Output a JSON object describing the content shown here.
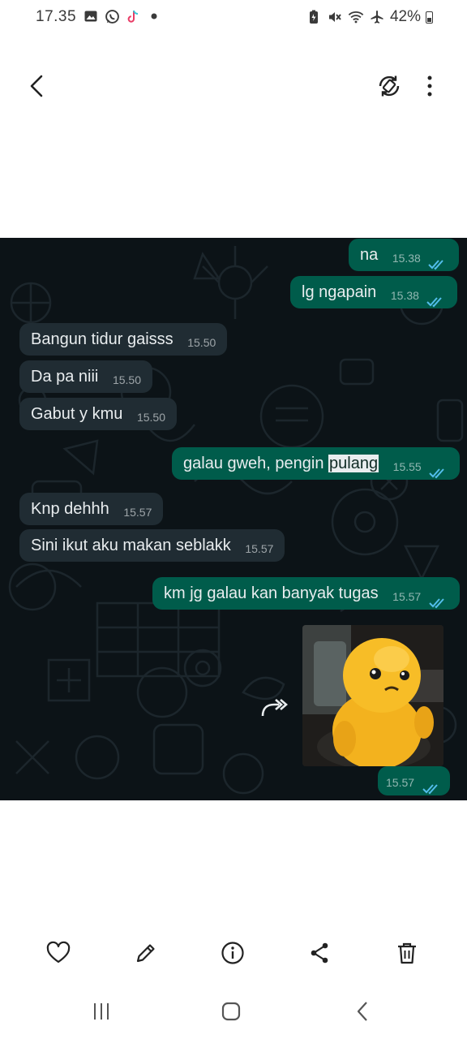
{
  "status_bar": {
    "time": "17.35",
    "left_icons": [
      "gallery-icon",
      "whatsapp-icon",
      "tiktok-icon",
      "dot-icon"
    ],
    "right_icons": [
      "battery-saver-icon",
      "mute-icon",
      "wifi-icon",
      "airplane-icon"
    ],
    "battery": "42%"
  },
  "app_bar": {
    "back_icon": "back-arrow-icon",
    "rotate_icon": "rotate-icon",
    "more_icon": "more-vert-icon"
  },
  "messages": [
    {
      "direction": "out",
      "text": "na",
      "time": "15.38",
      "read": true
    },
    {
      "direction": "out",
      "text": "lg ngapain",
      "time": "15.38",
      "read": true
    },
    {
      "direction": "in",
      "text": "Bangun tidur gaisss",
      "time": "15.50"
    },
    {
      "direction": "in",
      "text": "Da pa niii",
      "time": "15.50"
    },
    {
      "direction": "in",
      "text": "Gabut y kmu",
      "time": "15.50"
    },
    {
      "direction": "out",
      "text_before": "galau gweh, pengin ",
      "text_highlight": "pulang",
      "time": "15.55",
      "read": true
    },
    {
      "direction": "in",
      "text": "Knp dehhh",
      "time": "15.57"
    },
    {
      "direction": "in",
      "text": "Sini ikut aku makan seblakk",
      "time": "15.57"
    },
    {
      "direction": "out",
      "text": "km jg galau kan banyak tugas",
      "time": "15.57",
      "read": true
    },
    {
      "direction": "out",
      "type": "photo",
      "image": "yellow-duck-toy",
      "time": "15.57",
      "read": true
    }
  ],
  "colors": {
    "chat_background": "#0c1317",
    "incoming_bubble": "#202c33",
    "outgoing_bubble": "#005c4b",
    "read_tick": "#53bdeb"
  },
  "bottom_actions": [
    "heart-icon",
    "edit-icon",
    "info-icon",
    "share-icon",
    "delete-icon"
  ],
  "nav_bar": [
    "recent-apps-icon",
    "home-icon",
    "back-icon"
  ]
}
